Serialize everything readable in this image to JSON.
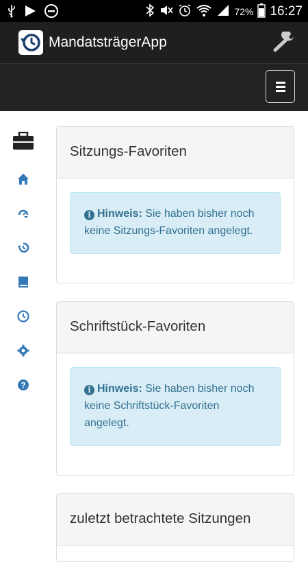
{
  "statusbar": {
    "battery": "72%",
    "time": "16:27"
  },
  "app": {
    "title": "MandatsträgerApp"
  },
  "sidebar": {
    "items": [
      {
        "name": "briefcase-icon"
      },
      {
        "name": "home-icon"
      },
      {
        "name": "dashboard-icon"
      },
      {
        "name": "history-icon"
      },
      {
        "name": "book-icon"
      },
      {
        "name": "clock-icon"
      },
      {
        "name": "settings-icon"
      },
      {
        "name": "help-icon"
      }
    ]
  },
  "panels": [
    {
      "title": "Sitzungs-Favoriten",
      "hint_label": "Hinweis:",
      "hint_text": " Sie haben bisher noch keine Sitzungs-Favoriten angelegt."
    },
    {
      "title": "Schriftstück-Favoriten",
      "hint_label": "Hinweis:",
      "hint_text": " Sie haben bisher noch keine Schriftstück-Favoriten angelegt."
    },
    {
      "title": "zuletzt betrachtete Sitzungen"
    }
  ],
  "colors": {
    "accent": "#337ab7",
    "alert_bg": "#d9edf7",
    "alert_text": "#31708f",
    "navbar": "#222222"
  }
}
